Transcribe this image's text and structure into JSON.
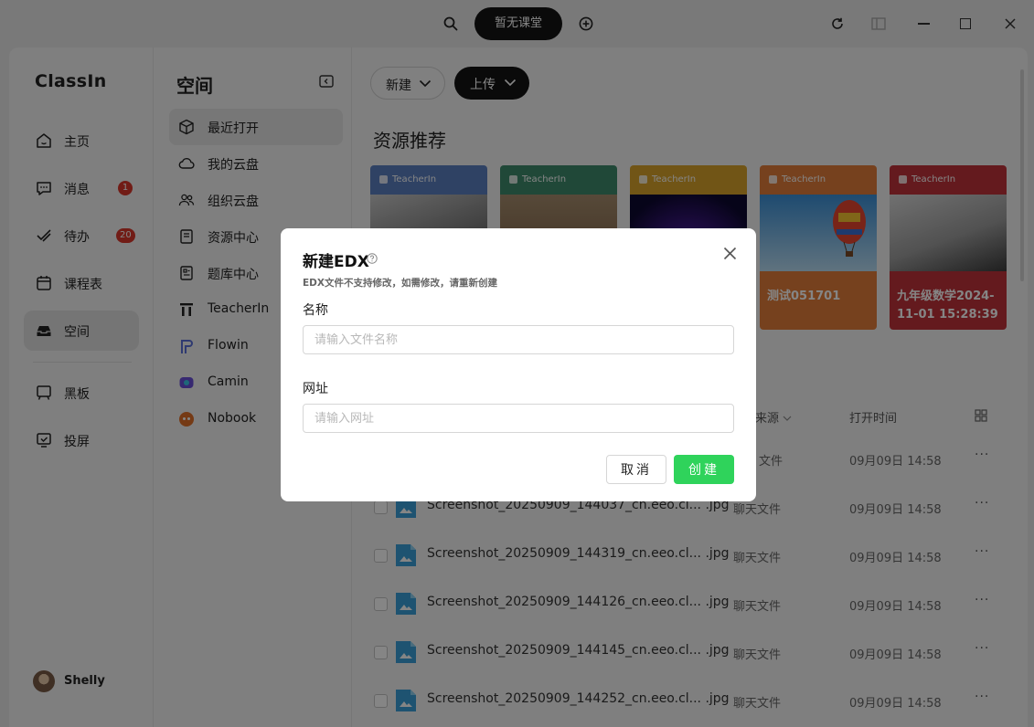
{
  "titlebar": {
    "classroom_pill": "暂无课堂",
    "icons": [
      "search-icon",
      "add-circle-icon",
      "refresh-icon",
      "layout-icon",
      "minimize-icon",
      "maximize-icon",
      "close-icon"
    ]
  },
  "app": {
    "logo": "ClassIn"
  },
  "nav": {
    "items": [
      {
        "label": "主页",
        "icon": "home-icon"
      },
      {
        "label": "消息",
        "icon": "message-icon",
        "badge": "1"
      },
      {
        "label": "待办",
        "icon": "todo-icon",
        "badge": "20"
      },
      {
        "label": "课程表",
        "icon": "calendar-icon"
      },
      {
        "label": "空间",
        "icon": "inbox-icon",
        "active": true
      },
      {
        "label": "黑板",
        "icon": "blackboard-icon"
      },
      {
        "label": "投屏",
        "icon": "cast-icon"
      }
    ],
    "user": "Shelly"
  },
  "space": {
    "title": "空间",
    "items": [
      {
        "label": "最近打开",
        "icon": "cube-icon",
        "active": true
      },
      {
        "label": "我的云盘",
        "icon": "cloud-icon"
      },
      {
        "label": "组织云盘",
        "icon": "group-icon"
      },
      {
        "label": "资源中心",
        "icon": "book-icon"
      },
      {
        "label": "题库中心",
        "icon": "question-bank-icon"
      },
      {
        "label": "TeacherIn",
        "icon": "teacherin-icon"
      },
      {
        "label": "Flowin",
        "icon": "flowin-icon"
      },
      {
        "label": "Camin",
        "icon": "camin-icon"
      },
      {
        "label": "Nobook",
        "icon": "nobook-icon"
      }
    ]
  },
  "main": {
    "new_button": "新建",
    "upload_button": "上传",
    "section_title": "资源推荐",
    "cards": [
      {
        "brand": "TeacherIn",
        "title": "",
        "color": "#5b7fc0"
      },
      {
        "brand": "TeacherIn",
        "title": "",
        "color": "#3e8a6c"
      },
      {
        "brand": "TeacherIn",
        "title": "",
        "color": "#d9a32b"
      },
      {
        "brand": "TeacherIn",
        "title": "测试051701",
        "color": "#e27d3a"
      },
      {
        "brand": "TeacherIn",
        "title": "九年级数学2024-11-01 15:28:39",
        "color": "#c0333a"
      }
    ],
    "table": {
      "col_source": "来源",
      "col_time": "打开时间",
      "rows": [
        {
          "name": "",
          "source": "文件",
          "time": "09月09日 14:58"
        },
        {
          "name": "Screenshot_20250909_144037_cn.eeo.cl... .jpg",
          "source": "聊天文件",
          "time": "09月09日 14:58"
        },
        {
          "name": "Screenshot_20250909_144319_cn.eeo.cl... .jpg",
          "source": "聊天文件",
          "time": "09月09日 14:58"
        },
        {
          "name": "Screenshot_20250909_144126_cn.eeo.cl... .jpg",
          "source": "聊天文件",
          "time": "09月09日 14:58"
        },
        {
          "name": "Screenshot_20250909_144145_cn.eeo.cl... .jpg",
          "source": "聊天文件",
          "time": "09月09日 14:58"
        },
        {
          "name": "Screenshot_20250909_144252_cn.eeo.cl... .jpg",
          "source": "聊天文件",
          "time": "09月09日 14:58"
        }
      ],
      "more": "···"
    }
  },
  "dialog": {
    "title": "新建EDX",
    "subtitle": "EDX文件不支持修改，如需修改，请重新创建",
    "name_label": "名称",
    "name_placeholder": "请输入文件名称",
    "url_label": "网址",
    "url_placeholder": "请输入网址",
    "cancel": "取消",
    "create": "创建"
  }
}
